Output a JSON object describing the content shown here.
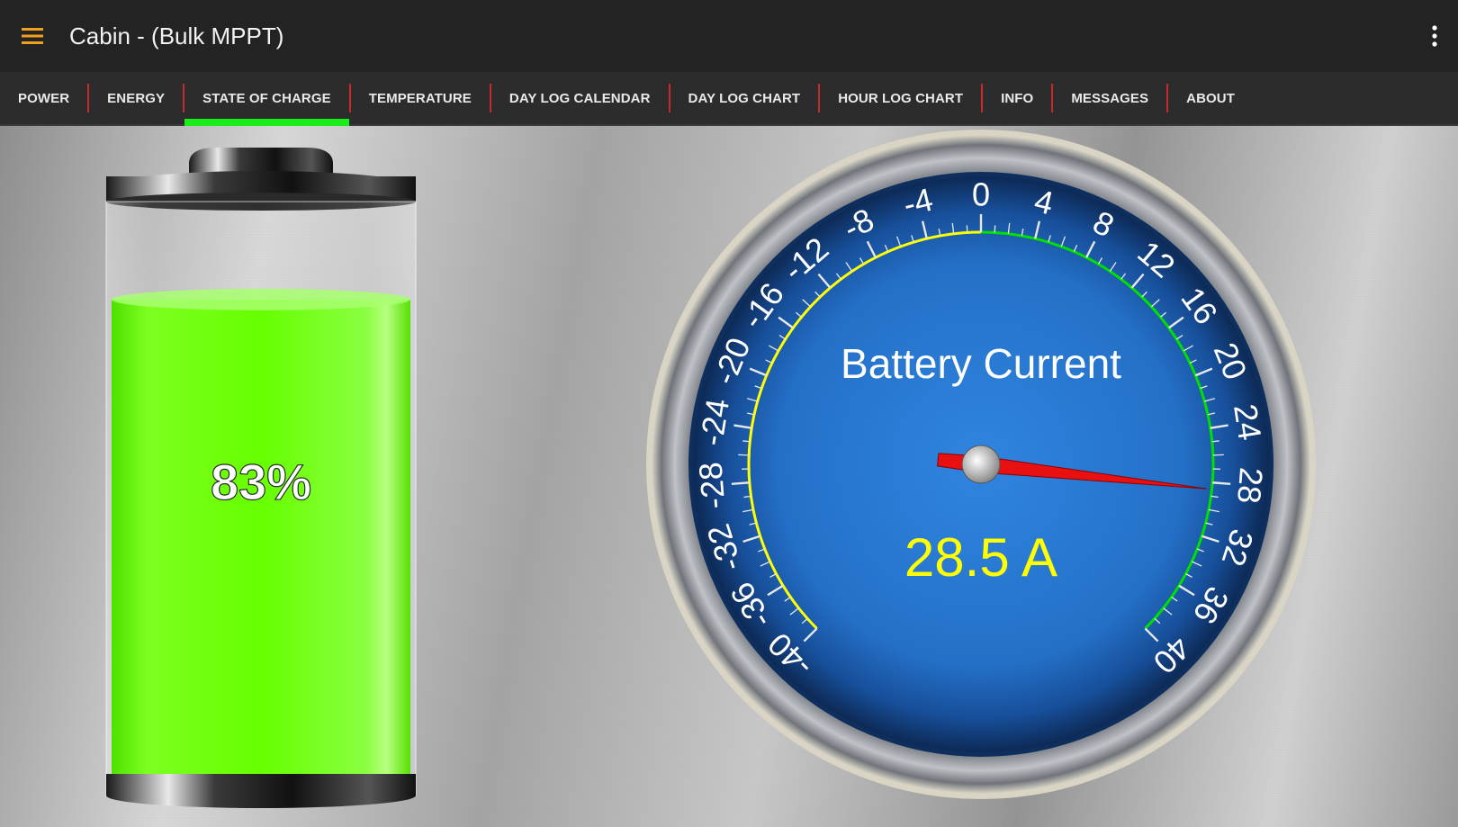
{
  "app": {
    "title": "Cabin - (Bulk MPPT)",
    "menu_icon": "hamburger-menu-icon",
    "overflow_icon": "more-vert-icon"
  },
  "tabs": [
    {
      "label": "POWER"
    },
    {
      "label": "ENERGY"
    },
    {
      "label": "STATE OF CHARGE",
      "active": true
    },
    {
      "label": "TEMPERATURE"
    },
    {
      "label": "DAY LOG CALENDAR"
    },
    {
      "label": "DAY LOG CHART"
    },
    {
      "label": "HOUR LOG CHART"
    },
    {
      "label": "INFO"
    },
    {
      "label": "MESSAGES"
    },
    {
      "label": "ABOUT"
    }
  ],
  "battery": {
    "percent_label": "83%",
    "level": 0.83,
    "fill_color": "#66ff00"
  },
  "gauge": {
    "title": "Battery Current",
    "value_label": "28.5 A",
    "value": 28.5,
    "min": -40,
    "max": 40,
    "major_step": 4,
    "tick_labels": [
      "-40",
      "-36",
      "-32",
      "-28",
      "-24",
      "-20",
      "-16",
      "-12",
      "-8",
      "-4",
      "0",
      "4",
      "8",
      "12",
      "16",
      "20",
      "24",
      "28",
      "32",
      "36",
      "40"
    ],
    "negative_arc_color": "#ffff00",
    "positive_arc_color": "#00e000",
    "needle_color": "#e81010",
    "value_color": "#ffff00",
    "face_color": "#2a7ad8"
  },
  "colors": {
    "accent": "#19ee19",
    "tab_separator": "#c42a2a",
    "menu_icon": "#f0a020"
  }
}
